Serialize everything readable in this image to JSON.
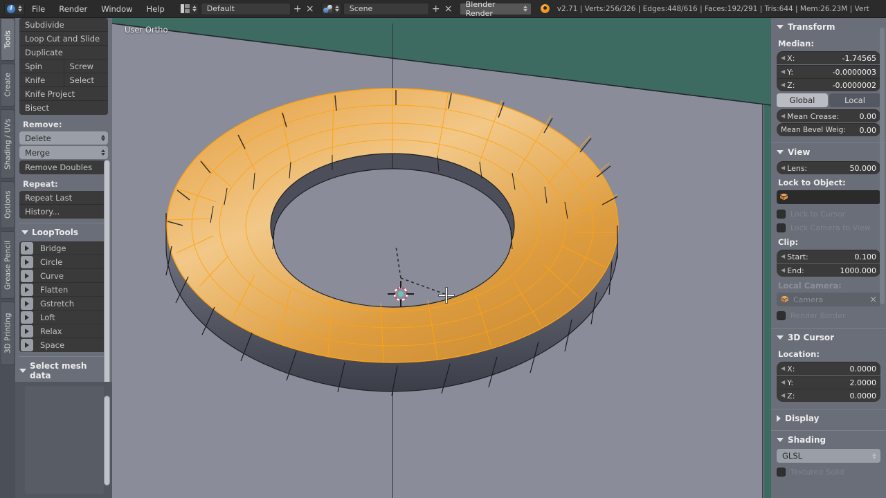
{
  "app": {
    "title": "Blender",
    "version_stats": "v2.71 | Verts:256/326 | Edges:448/616 | Faces:192/291 | Tris:644 | Mem:26.23M | Vert"
  },
  "topbar": {
    "info_icon": "info-editor-icon",
    "menus": [
      "File",
      "Render",
      "Window",
      "Help"
    ],
    "screen_icon": "screen-layout-icon",
    "screen_value": "Default",
    "screen_add": "+",
    "screen_remove": "×",
    "scene_icon": "scene-icon",
    "scene_value": "Scene",
    "scene_add": "+",
    "scene_remove": "×",
    "engine_icon": "chevron-updown-icon",
    "engine_value": "Blender Render",
    "blender_logo": "blender-logo-icon"
  },
  "tabs": {
    "items": [
      {
        "label": "Tools",
        "active": true
      },
      {
        "label": "Create",
        "active": false
      },
      {
        "label": "Shading / UVs",
        "active": false
      },
      {
        "label": "Options",
        "active": false
      },
      {
        "label": "Grease Pencil",
        "active": false
      },
      {
        "label": "3D Printing",
        "active": false
      }
    ]
  },
  "toolshelf": {
    "mesh_tools": [
      "Subdivide",
      "Loop Cut and Slide",
      "Duplicate"
    ],
    "mesh_tools_pairs": [
      [
        "Spin",
        "Screw"
      ],
      [
        "Knife",
        "Select"
      ]
    ],
    "mesh_tools_after": [
      "Knife Project",
      "Bisect"
    ],
    "remove_label": "Remove:",
    "remove_dropdowns": [
      "Delete",
      "Merge"
    ],
    "remove_button": "Remove Doubles",
    "repeat_label": "Repeat:",
    "repeat_buttons": [
      "Repeat Last",
      "History..."
    ],
    "looptools_header": "LoopTools",
    "looptools_items": [
      "Bridge",
      "Circle",
      "Curve",
      "Flatten",
      "Gstretch",
      "Loft",
      "Relax",
      "Space"
    ],
    "select_mesh_data_header": "Select mesh data"
  },
  "viewport": {
    "view_label": "User Ortho",
    "bg_plane_color": "#3d6b62",
    "floor_color": "#8a8d99",
    "mesh_selected_color": "#e8a33d",
    "mesh_wire_color": "#ffa313",
    "cursor_3d_icon": "3d-cursor-icon",
    "mouse_cursor_icon": "crosshair-cursor-icon"
  },
  "properties": {
    "transform": {
      "header": "Transform",
      "median_label": "Median:",
      "median": [
        {
          "axis": "X:",
          "value": "-1.74565"
        },
        {
          "axis": "Y:",
          "value": "-0.0000003"
        },
        {
          "axis": "Z:",
          "value": "-0.0000002"
        }
      ],
      "space_global": "Global",
      "space_local": "Local",
      "space_active": "Global",
      "mean_crease_label": "Mean Crease:",
      "mean_crease_value": "0.00",
      "mean_bevel_label": "Mean Bevel Weig:",
      "mean_bevel_value": "0.00"
    },
    "view": {
      "header": "View",
      "lens_label": "Lens:",
      "lens_value": "50.000",
      "lock_to_object_label": "Lock to Object:",
      "lock_to_object_value": "",
      "lock_to_object_icon": "object-cube-icon",
      "lock_to_cursor": "Lock to Cursor",
      "lock_camera_to_view": "Lock Camera to View",
      "clip_label": "Clip:",
      "clip_start_label": "Start:",
      "clip_start_value": "0.100",
      "clip_end_label": "End:",
      "clip_end_value": "1000.000",
      "local_camera_label": "Local Camera:",
      "local_camera_value": "Camera",
      "local_camera_icon": "object-cube-icon",
      "local_camera_clear": "×",
      "render_border": "Render Border"
    },
    "cursor3d": {
      "header": "3D Cursor",
      "location_label": "Location:",
      "location": [
        {
          "axis": "X:",
          "value": "0.0000"
        },
        {
          "axis": "Y:",
          "value": "2.0000"
        },
        {
          "axis": "Z:",
          "value": "0.0000"
        }
      ]
    },
    "display": {
      "header": "Display"
    },
    "shading": {
      "header": "Shading",
      "mode_value": "GLSL",
      "textured_solid": "Textured Solid"
    }
  }
}
